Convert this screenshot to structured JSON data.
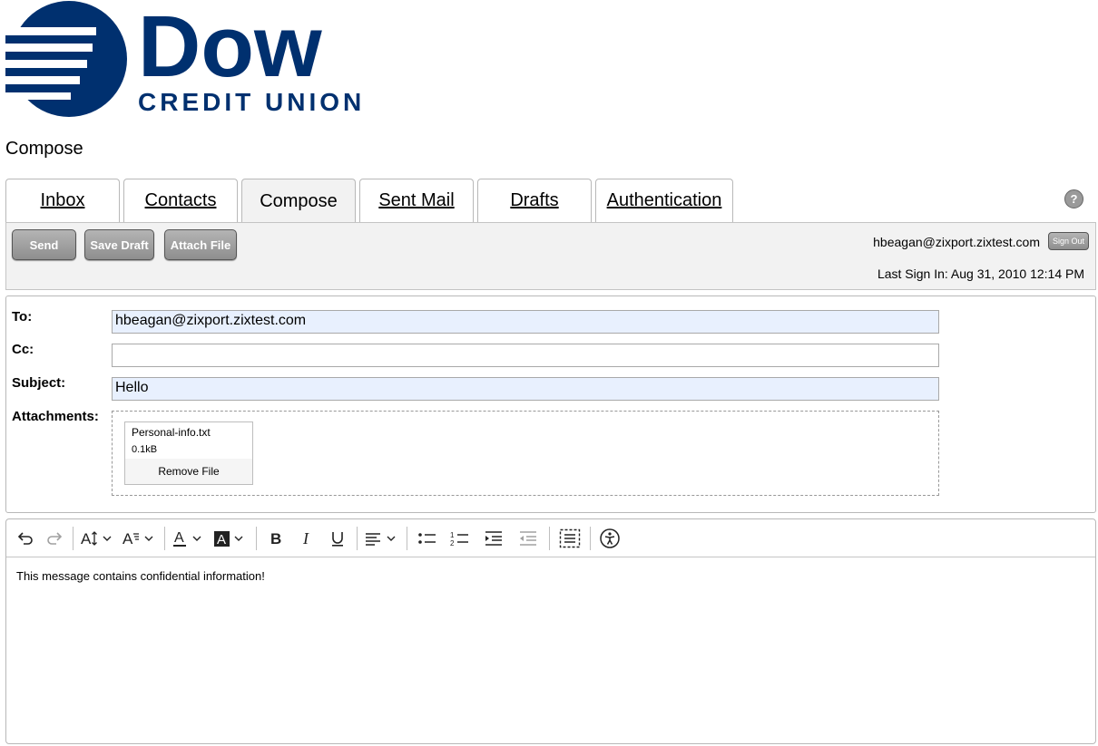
{
  "brand": {
    "name": "Dow",
    "subtitle": "CREDIT UNION",
    "color": "#00306f"
  },
  "page_heading": "Compose",
  "tabs": [
    {
      "label": "Inbox",
      "active": false
    },
    {
      "label": "Contacts",
      "active": false
    },
    {
      "label": "Compose",
      "active": true
    },
    {
      "label": "Sent Mail",
      "active": false
    },
    {
      "label": "Drafts",
      "active": false
    },
    {
      "label": "Authentication",
      "active": false
    }
  ],
  "help_label": "?",
  "toolbar": {
    "send_label": "Send",
    "save_draft_label": "Save Draft",
    "attach_file_label": "Attach File",
    "user_email": "hbeagan@zixport.zixtest.com",
    "sign_out_label": "Sign Out",
    "last_sign_in_label": "Last Sign In:",
    "last_sign_in_value": "Aug 31, 2010 12:14 PM"
  },
  "form": {
    "to_label": "To:",
    "to_value": "hbeagan@zixport.zixtest.com",
    "cc_label": "Cc:",
    "cc_value": "",
    "subject_label": "Subject:",
    "subject_value": "Hello",
    "attachments_label": "Attachments:",
    "attachment": {
      "name": "Personal-info.txt",
      "size": "0.1kB",
      "remove_label": "Remove File"
    }
  },
  "editor": {
    "body_text": "This message contains confidential information!"
  }
}
